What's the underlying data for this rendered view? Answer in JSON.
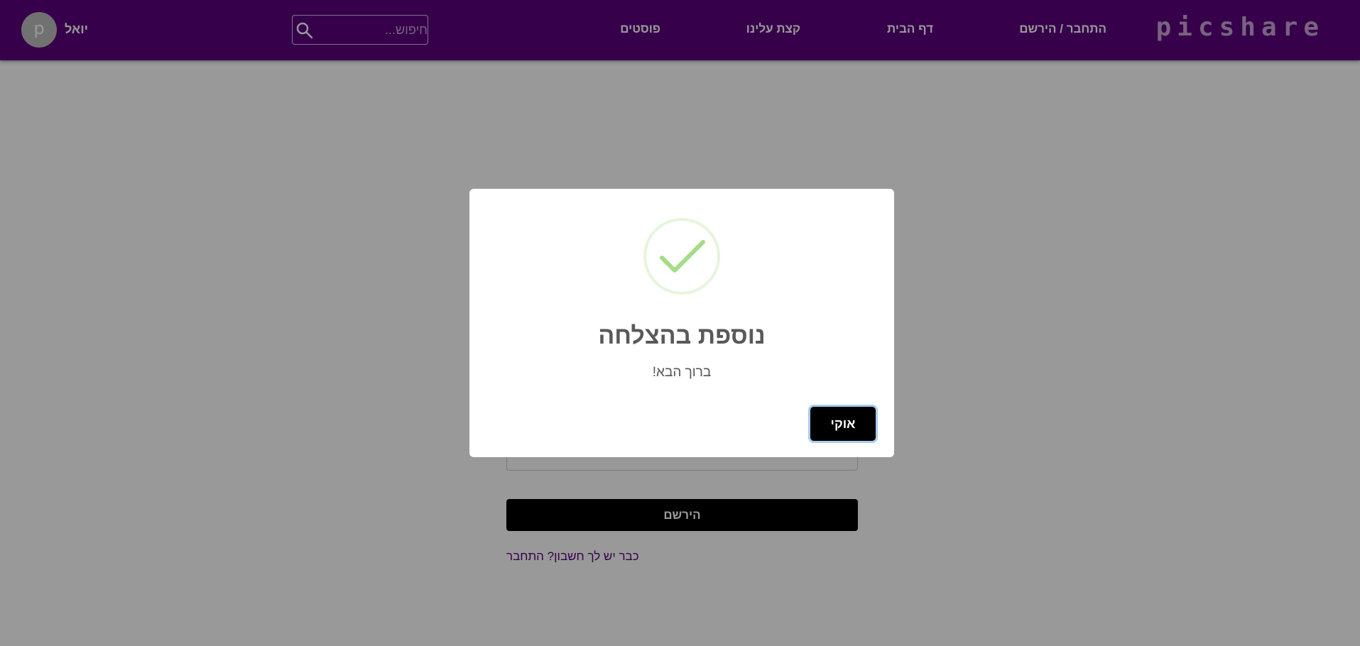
{
  "header": {
    "logo": "picshare",
    "nav": {
      "login_register": "התחבר / הירשם",
      "home": "דף הבית",
      "about": "קצת עלינו",
      "posts": "פוסטים"
    },
    "search": {
      "placeholder": "חיפוש...",
      "icon": "search-icon"
    },
    "user": {
      "avatar_letter": "p",
      "name": "יואל"
    }
  },
  "form": {
    "register_button": "הירשם",
    "login_link": "כבר יש לך חשבון? התחבר"
  },
  "modal": {
    "icon": "check-icon",
    "title": "נוספת בהצלחה",
    "text": "ברוך הבא!",
    "ok_button": "אוקי"
  },
  "colors": {
    "header_bg": "#5b007e",
    "logo": "#c9a6d6",
    "success_green": "#a5dc86",
    "button_bg": "#000000"
  }
}
